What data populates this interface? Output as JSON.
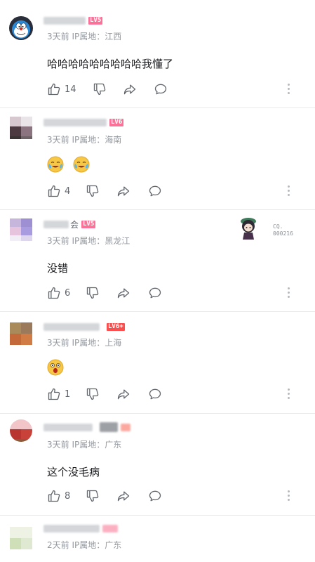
{
  "colors": {
    "level_badge": "#fb7299",
    "meta_text": "#9499a0",
    "content_text": "#18191c",
    "action_icon": "#61666d"
  },
  "comments": [
    {
      "level": "LV5",
      "meta": "3天前 IP属地：江西",
      "content": "哈哈哈哈哈哈哈哈哈我懂了",
      "likes": "14",
      "avatar": "doraemon-avatar"
    },
    {
      "level": "LV6",
      "meta": "3天前 IP属地：海南",
      "content_emojis": [
        "laughing-crying-emoji",
        "laughing-crying-emoji"
      ],
      "likes": "4"
    },
    {
      "name_suffix": "会",
      "level": "LV5",
      "meta": "3天前 IP属地：黑龙江",
      "content": "没错",
      "likes": "6",
      "fan_badge_text": "CQ.\n000216"
    },
    {
      "level": "LV6+",
      "meta": "3天前 IP属地：上海",
      "content_emojis": [
        "surprised-emoji"
      ],
      "likes": "1"
    },
    {
      "meta": "3天前 IP属地：广东",
      "content": "这个没毛病",
      "likes": "8"
    },
    {
      "meta": "2天前 IP属地：广东"
    }
  ]
}
